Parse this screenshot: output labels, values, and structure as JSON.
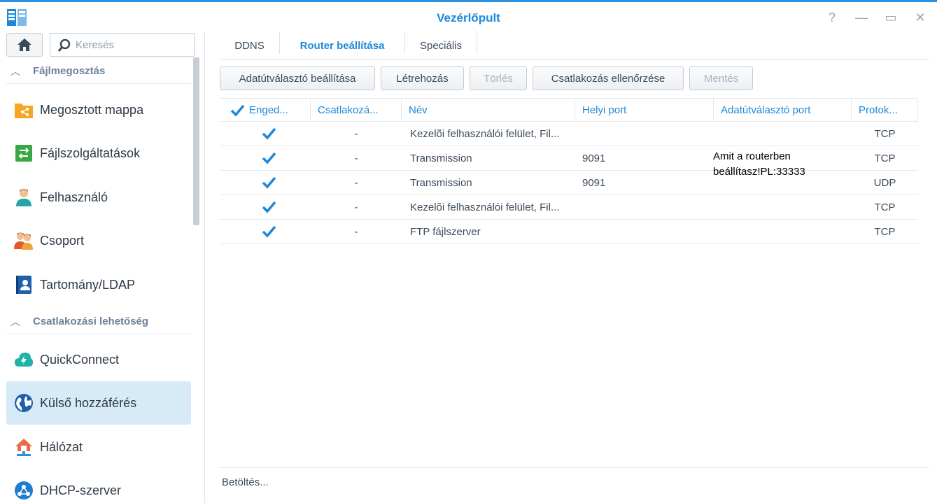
{
  "window": {
    "title": "Vezérlőpult",
    "help_glyph": "?",
    "minimize_glyph": "—",
    "maximize_glyph": "▭",
    "close_glyph": "✕"
  },
  "sidebar": {
    "search_placeholder": "Keresés",
    "sections": [
      {
        "label": "Fájlmegosztás",
        "icon": "chevron-up-icon"
      },
      {
        "label": "Csatlakozási lehetőség",
        "icon": "chevron-up-icon"
      }
    ],
    "items": [
      {
        "label": "Megosztott mappa",
        "icon": "shared-folder-icon"
      },
      {
        "label": "Fájlszolgáltatások",
        "icon": "file-services-icon"
      },
      {
        "label": "Felhasználó",
        "icon": "user-icon"
      },
      {
        "label": "Csoport",
        "icon": "group-icon"
      },
      {
        "label": "Tartomány/LDAP",
        "icon": "domain-ldap-icon"
      },
      {
        "label": "QuickConnect",
        "icon": "quickconnect-icon"
      },
      {
        "label": "Külső hozzáférés",
        "icon": "globe-icon",
        "active": true
      },
      {
        "label": "Hálózat",
        "icon": "network-house-icon"
      },
      {
        "label": "DHCP-szerver",
        "icon": "dhcp-icon"
      }
    ]
  },
  "tabs": [
    {
      "label": "DDNS",
      "active": false
    },
    {
      "label": "Router beállítása",
      "active": true
    },
    {
      "label": "Speciális",
      "active": false
    }
  ],
  "toolbar": {
    "router_setup": "Adatútválasztó beállítása",
    "create": "Létrehozás",
    "delete": "Törlés",
    "test_connection": "Csatlakozás ellenőrzése",
    "save": "Mentés"
  },
  "table": {
    "columns": [
      "Enged...",
      "Csatlakozá...",
      "Név",
      "Helyi port",
      "Adatútválasztó port",
      "Protok..."
    ],
    "rows": [
      {
        "enabled": true,
        "connection": "-",
        "name": "Kezelõi felhasználói felület, Fil...",
        "local_port": "",
        "router_port": "",
        "protocol": "TCP"
      },
      {
        "enabled": true,
        "connection": "-",
        "name": "Transmission",
        "local_port": "9091",
        "router_port": "",
        "protocol": "TCP"
      },
      {
        "enabled": true,
        "connection": "-",
        "name": "Transmission",
        "local_port": "9091",
        "router_port": "",
        "protocol": "UDP"
      },
      {
        "enabled": true,
        "connection": "-",
        "name": "Kezelõi felhasználói felület, Fil...",
        "local_port": "",
        "router_port": "",
        "protocol": "TCP"
      },
      {
        "enabled": true,
        "connection": "-",
        "name": "FTP fájlszerver",
        "local_port": "",
        "router_port": "",
        "protocol": "TCP"
      }
    ]
  },
  "annotation": "Amit a routerben\nbeállítasz!PL:33333",
  "status": "Betöltés...",
  "colors": {
    "accent": "#1d88d9",
    "active_item_bg": "#d7eaf8",
    "section_text": "#6b8299"
  }
}
